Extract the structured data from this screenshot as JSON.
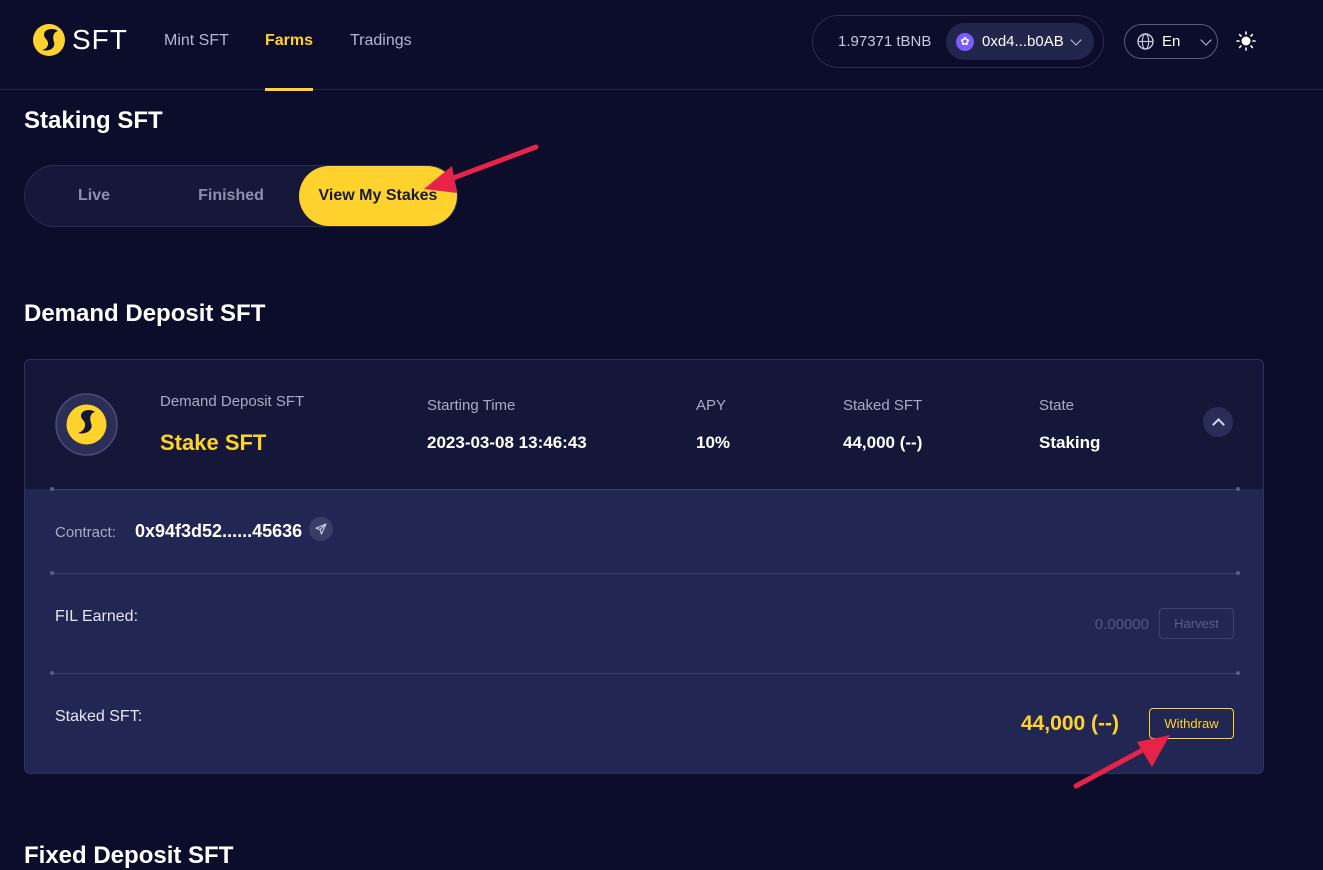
{
  "header": {
    "logo_text": "SFT",
    "nav": [
      {
        "label": "Mint SFT",
        "active": false
      },
      {
        "label": "Farms",
        "active": true
      },
      {
        "label": "Tradings",
        "active": false
      }
    ],
    "wallet": {
      "balance": "1.97371 tBNB",
      "account": "0xd4...b0AB"
    },
    "language": "En",
    "icons": {
      "globe": "globe-icon",
      "theme": "sun-icon"
    }
  },
  "page": {
    "title": "Staking SFT",
    "tabs": [
      {
        "label": "Live",
        "active": false
      },
      {
        "label": "Finished",
        "active": false
      },
      {
        "label": "View My Stakes",
        "active": true
      }
    ],
    "section_title": "Demand Deposit SFT",
    "next_section_title": "Fixed Deposit SFT"
  },
  "card": {
    "pool_subtitle": "Demand Deposit SFT",
    "pool_name": "Stake SFT",
    "columns": [
      {
        "label": "Starting Time",
        "value": "2023-03-08 13:46:43"
      },
      {
        "label": "APY",
        "value": "10%"
      },
      {
        "label": "Staked SFT",
        "value": "44,000 (--)"
      },
      {
        "label": "State",
        "value": "Staking"
      }
    ],
    "contract": {
      "label": "Contract:",
      "value": "0x94f3d52......45636"
    },
    "earned": {
      "label": "FIL Earned:",
      "amount": "0.00000",
      "button": "Harvest"
    },
    "staked": {
      "label": "Staked SFT:",
      "amount": "44,000 (--)",
      "button": "Withdraw"
    }
  },
  "colors": {
    "background": "#0b0d2b",
    "accent": "#ffd22e",
    "card": "#222652",
    "annotation": "#e8234a"
  }
}
